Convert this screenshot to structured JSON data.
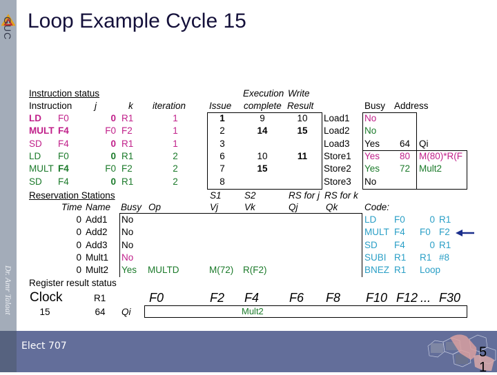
{
  "slide": {
    "title": "Loop Example Cycle 15",
    "logo_text": "GUC",
    "author": "Dr. Amr Talaat",
    "footer_text": "Elect 707",
    "page_number": "51"
  },
  "instruction_status": {
    "heading": "Instruction status",
    "headers": {
      "instruction": "Instruction",
      "j": "j",
      "k": "k",
      "iteration": "iteration",
      "exec_top": "Execution",
      "write_top": "Write",
      "issue": "Issue",
      "complete": "complete",
      "result": "Result"
    },
    "rows": [
      {
        "op": "LD",
        "dest": "F0",
        "j": "0",
        "k": "R1",
        "iteration": "1",
        "issue": "1",
        "exec": "9",
        "write": "10",
        "color": "mag"
      },
      {
        "op": "MULT",
        "dest": "F4",
        "j": "F0",
        "k": "F2",
        "iteration": "1",
        "issue": "2",
        "exec": "14",
        "write": "15",
        "color": "mag"
      },
      {
        "op": "SD",
        "dest": "F4",
        "j": "0",
        "k": "R1",
        "iteration": "1",
        "issue": "3",
        "exec": "",
        "write": "",
        "color": "mag"
      },
      {
        "op": "LD",
        "dest": "F0",
        "j": "0",
        "k": "R1",
        "iteration": "2",
        "issue": "6",
        "exec": "10",
        "write": "11",
        "color": "grn"
      },
      {
        "op": "MULT",
        "dest": "F4",
        "j": "F0",
        "k": "F2",
        "iteration": "2",
        "issue": "7",
        "exec": "15",
        "write": "",
        "color": "grn"
      },
      {
        "op": "SD",
        "dest": "F4",
        "j": "0",
        "k": "R1",
        "iteration": "2",
        "issue": "8",
        "exec": "",
        "write": "",
        "color": "grn"
      }
    ]
  },
  "load_store_buffers": {
    "headers": {
      "busy": "Busy",
      "address": "Address"
    },
    "rows": [
      {
        "name": "Load1",
        "busy": "No",
        "address": "",
        "extra": "",
        "color": "mag"
      },
      {
        "name": "Load2",
        "busy": "No",
        "address": "",
        "extra": "",
        "color": "grn"
      },
      {
        "name": "Load3",
        "busy": "Yes",
        "address": "64",
        "extra": "Qi",
        "color": "blk"
      },
      {
        "name": "Store1",
        "busy": "Yes",
        "address": "80",
        "extra": "M(80)*R(F",
        "color": "mag"
      },
      {
        "name": "Store2",
        "busy": "Yes",
        "address": "72",
        "extra": "Mult2",
        "color": "grn"
      },
      {
        "name": "Store3",
        "busy": "No",
        "address": "",
        "extra": "",
        "color": "blk"
      }
    ]
  },
  "reservation_stations": {
    "heading": "Reservation Stations",
    "headers": {
      "time": "Time",
      "name": "Name",
      "busy": "Busy",
      "op": "Op",
      "s1": "S1",
      "s2": "S2",
      "rsj": "RS for j",
      "rsk": "RS for k",
      "vj": "Vj",
      "vk": "Vk",
      "qj": "Qj",
      "qk": "Qk"
    },
    "rows": [
      {
        "time": "0",
        "name": "Add1",
        "busy": "No",
        "op": "",
        "vj": "",
        "vk": "",
        "qj": "",
        "qk": "",
        "color": "blk"
      },
      {
        "time": "0",
        "name": "Add2",
        "busy": "No",
        "op": "",
        "vj": "",
        "vk": "",
        "qj": "",
        "qk": "",
        "color": "blk"
      },
      {
        "time": "0",
        "name": "Add3",
        "busy": "No",
        "op": "",
        "vj": "",
        "vk": "",
        "qj": "",
        "qk": "",
        "color": "blk"
      },
      {
        "time": "0",
        "name": "Mult1",
        "busy": "No",
        "op": "",
        "vj": "",
        "vk": "",
        "qj": "",
        "qk": "",
        "color": "mag"
      },
      {
        "time": "0",
        "name": "Mult2",
        "busy": "Yes",
        "op": "MULTD",
        "vj": "M(72)",
        "vk": "R(F2)",
        "qj": "",
        "qk": "",
        "color": "grn"
      }
    ]
  },
  "code": {
    "heading": "Code:",
    "lines": [
      {
        "op": "LD",
        "a": "F0",
        "b": "0",
        "c": "R1"
      },
      {
        "op": "MULT",
        "a": "F4",
        "b": "F0",
        "c": "F2"
      },
      {
        "op": "SD",
        "a": "F4",
        "b": "0",
        "c": "R1"
      },
      {
        "op": "SUBI",
        "a": "R1",
        "b": "R1",
        "c": "#8"
      },
      {
        "op": "BNEZ",
        "a": "R1",
        "b": "Loop",
        "c": ""
      }
    ],
    "current_line_index": 1,
    "pointer_icon": "left-arrow-icon"
  },
  "register_status": {
    "heading": "Register result status",
    "clock_label": "Clock",
    "clock_value": "15",
    "r1_label": "R1",
    "r1_value": "64",
    "qi_label": "Qi",
    "registers": [
      "F0",
      "F2",
      "F4",
      "F6",
      "F8",
      "F10",
      "F12",
      "...",
      "F30"
    ],
    "qi_values": {
      "F4": "Mult2"
    }
  },
  "colors": {
    "iteration1": "#c0208a",
    "iteration2": "#1b7a2a",
    "code": "#2a9fc6",
    "footer_bg": "#636e9a",
    "sidebar_bg": "#a3acb9",
    "title": "#14103a",
    "arrow": "#1a2e8c"
  }
}
